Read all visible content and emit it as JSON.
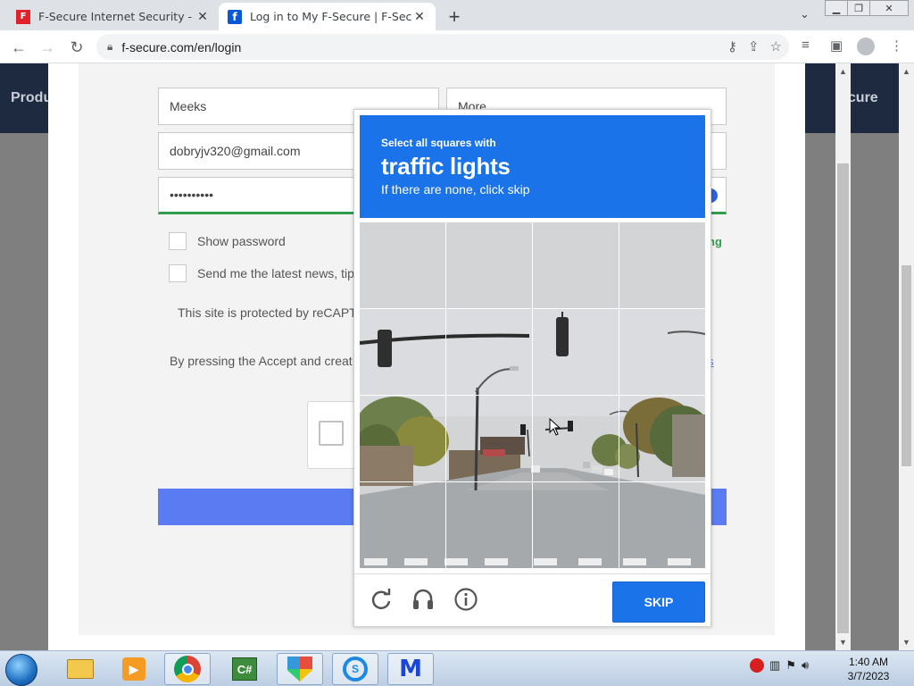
{
  "browser": {
    "tabs": [
      {
        "title": "F-Secure Internet Security - Скач",
        "favicon": "fsecure-red-icon",
        "active": false
      },
      {
        "title": "Log in to My F-Secure | F-Secure",
        "favicon": "fsecure-blue-icon",
        "active": true
      }
    ],
    "url": "f-secure.com/en/login"
  },
  "page": {
    "nav_left": "Produ",
    "nav_right": "ecure",
    "fields": {
      "last_name": "Meeks",
      "first_name": "More",
      "email": "dobryjv320@gmail.com",
      "password": "••••••••••"
    },
    "show_password_label": "Show password",
    "newsletter_label": "Send me the latest news, tip",
    "strength_text": "ng",
    "recaptcha_notice": "This site is protected by reCAPT",
    "terms_text": "By pressing the Accept and creat",
    "terms_link": "s"
  },
  "captcha": {
    "instruction_small": "Select all squares with",
    "instruction_big": "traffic lights",
    "instruction_sub": "If there are none, click skip",
    "skip_label": "SKIP",
    "icons": [
      "reload-icon",
      "audio-icon",
      "info-icon"
    ]
  },
  "taskbar": {
    "apps": [
      "explorer-icon",
      "media-player-icon",
      "chrome-icon",
      "csharp-icon",
      "shield-app-icon",
      "sync-app-icon",
      "malwarebytes-icon"
    ],
    "time": "1:40 AM",
    "date": "3/7/2023"
  },
  "colors": {
    "captcha_blue": "#1a73e8",
    "strength_green": "#2e9e4a",
    "submit_blue": "#5a7bf2",
    "nav_dark": "#1d2a3f"
  }
}
